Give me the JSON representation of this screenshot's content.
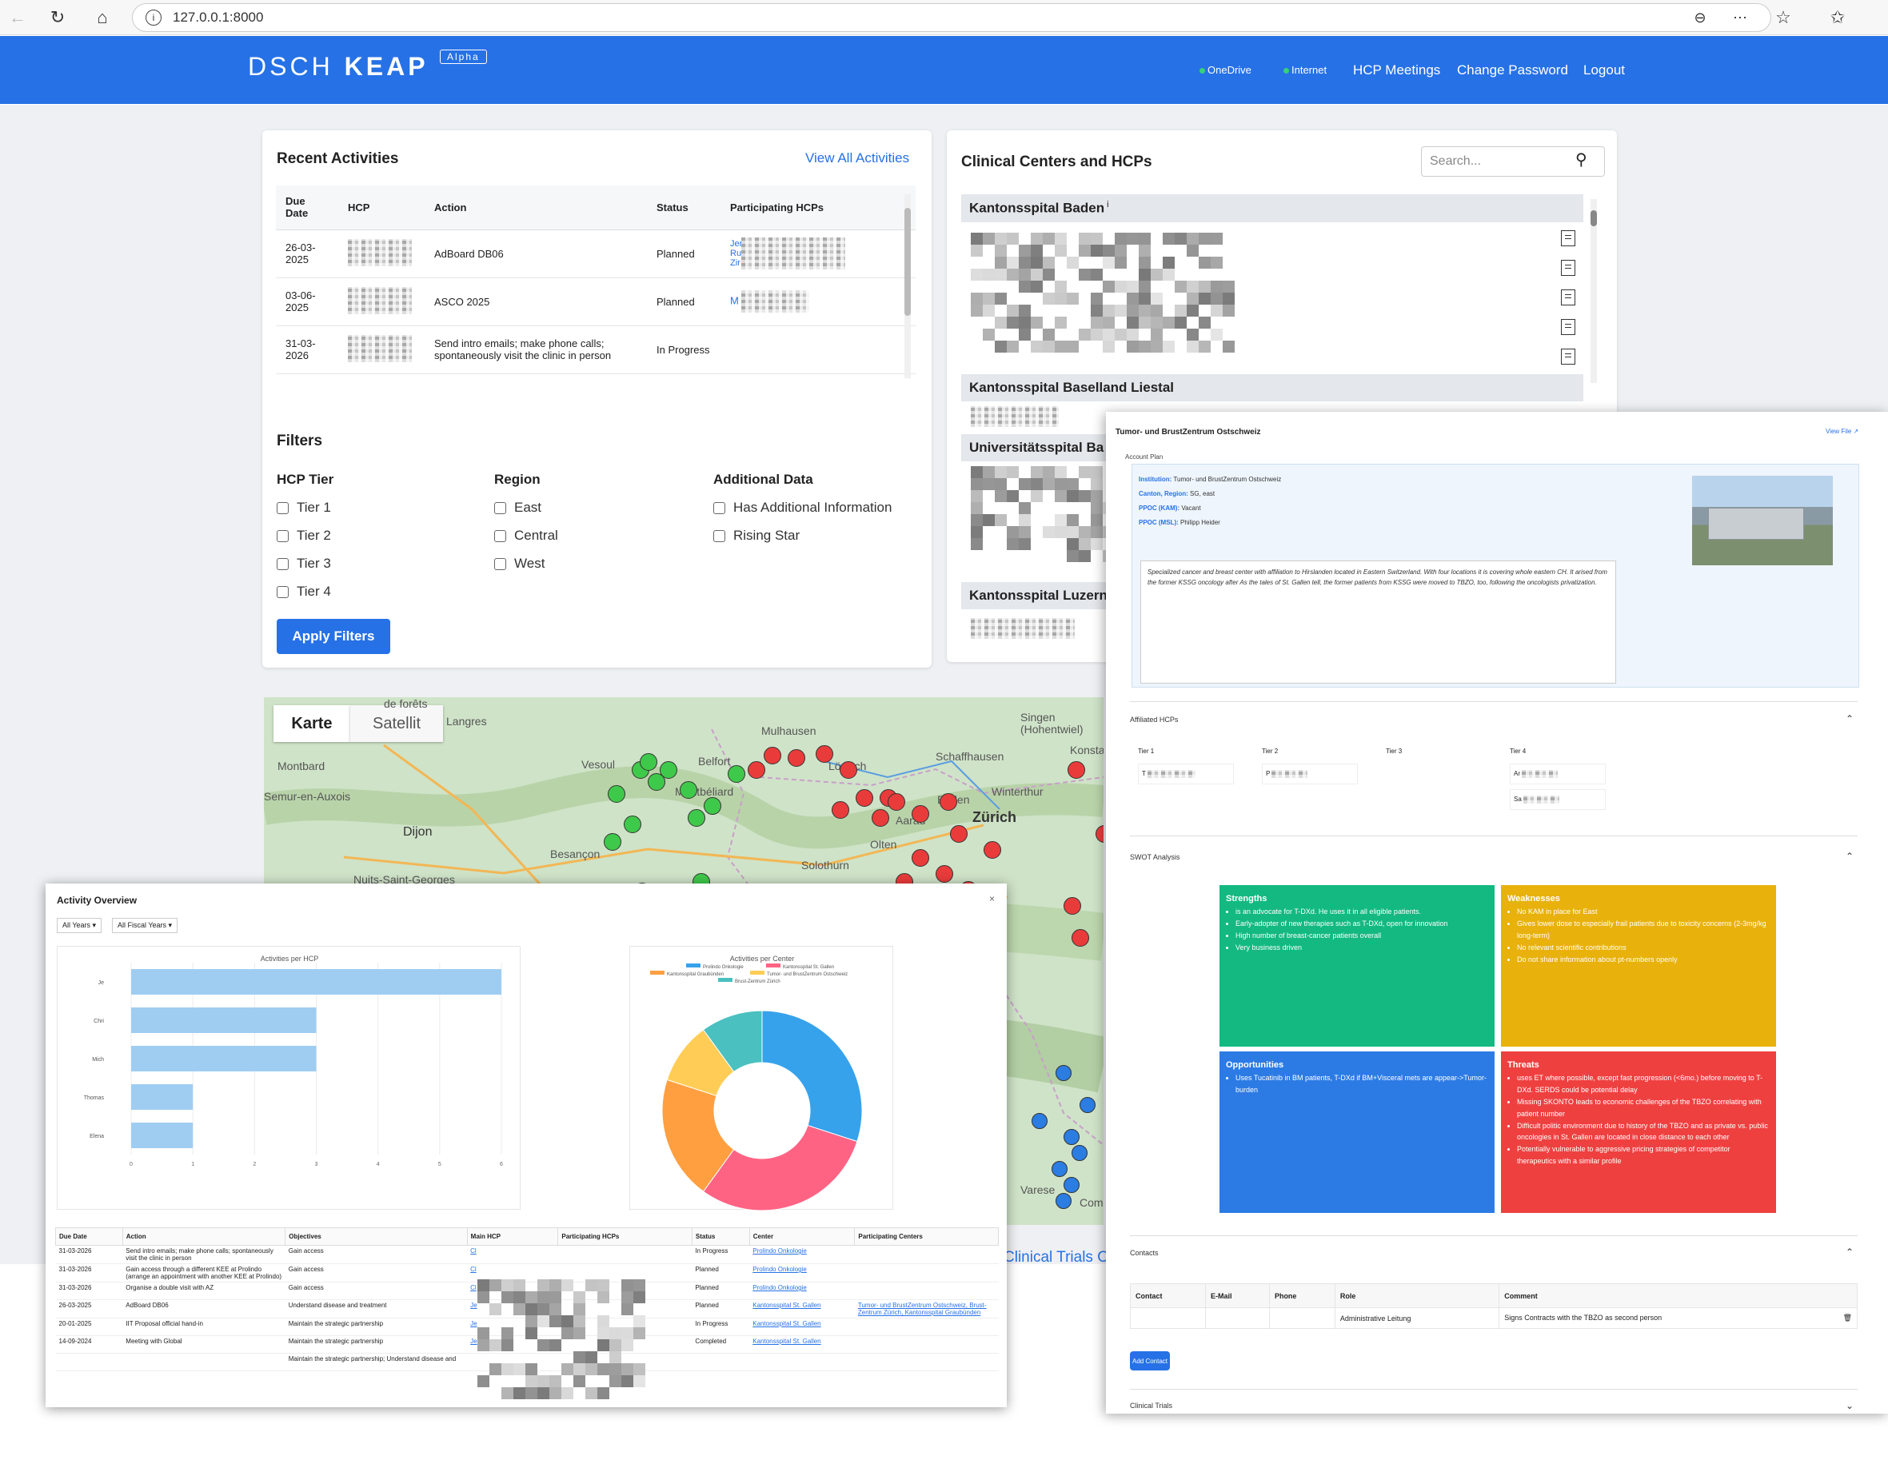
{
  "browser": {
    "url": "127.0.0.1:8000"
  },
  "app": {
    "brand_light": "DSCH",
    "brand_bold": "KEAP",
    "badge": "Alpha",
    "nav": {
      "onedrive": "OneDrive",
      "internet": "Internet",
      "hcp_meetings": "HCP Meetings",
      "change_password": "Change Password",
      "logout": "Logout"
    }
  },
  "recent": {
    "title": "Recent Activities",
    "view_all": "View All Activities",
    "headers": {
      "due": "Due Date",
      "hcp": "HCP",
      "action": "Action",
      "status": "Status",
      "participants": "Participating HCPs"
    },
    "rows": [
      {
        "due": "26-03-2025",
        "action": "AdBoard DB06",
        "status": "Planned",
        "participants": "Jer Ru Zir"
      },
      {
        "due": "03-06-2025",
        "action": "ASCO 2025",
        "status": "Planned",
        "participants": "M"
      },
      {
        "due": "31-03-2026",
        "action": "Send intro emails; make phone calls; spontaneously visit the clinic in person",
        "status": "In Progress",
        "participants": ""
      }
    ]
  },
  "filters": {
    "title": "Filters",
    "groups": {
      "tier": {
        "label": "HCP Tier",
        "options": [
          "Tier 1",
          "Tier 2",
          "Tier 3",
          "Tier 4"
        ]
      },
      "region": {
        "label": "Region",
        "options": [
          "East",
          "Central",
          "West"
        ]
      },
      "additional": {
        "label": "Additional Data",
        "options": [
          "Has Additional Information",
          "Rising Star"
        ]
      }
    },
    "apply": "Apply Filters"
  },
  "centers": {
    "title": "Clinical Centers and HCPs",
    "search_placeholder": "Search...",
    "items": [
      "Kantonsspital Baden",
      "Kantonsspital Baselland Liestal",
      "Universitätsspital Ba",
      "Kantonsspital Luzern"
    ]
  },
  "map": {
    "tab_map": "Karte",
    "tab_sat": "Satellit",
    "labels": [
      "de forêts",
      "Langres",
      "Singen (Hohentwiel)",
      "Mulhausen",
      "Lörrach",
      "Schaffhausen",
      "Konsta",
      "Montbard",
      "Vesoul",
      "Belfort",
      "Montbéliard",
      "Semur-en-Auxois",
      "Baden",
      "Winterthur",
      "Zürich",
      "Dijon",
      "Besançon",
      "Aarau",
      "Olten",
      "Solothurn",
      "Nuits-Saint-Georges",
      "Varese",
      "Com"
    ],
    "footer_link": "Clinical Trials Ov"
  },
  "overview": {
    "title": "Activity Overview",
    "year_filter": "All Years",
    "fiscal_filter": "All Fiscal Years",
    "close": "×",
    "bar_title": "Activities per HCP",
    "pie_title": "Activities per Center",
    "table_headers": [
      "Due Date",
      "Action",
      "Objectives",
      "Main HCP",
      "Participating HCPs",
      "Status",
      "Center",
      "Participating Centers"
    ],
    "table_rows": [
      {
        "due": "31-03-2026",
        "action": "Send intro emails; make phone calls; spontaneously visit the clinic in person",
        "objective": "Gain access",
        "hcp": "Cl",
        "status": "In Progress",
        "center": "Prolindo Onkologie",
        "pcenters": ""
      },
      {
        "due": "31-03-2026",
        "action": "Gain access through a different KEE at Prolindo (arrange an appointment with another KEE at Prolindo)",
        "objective": "Gain access",
        "hcp": "Cl",
        "status": "Planned",
        "center": "Prolindo Onkologie",
        "pcenters": ""
      },
      {
        "due": "31-03-2026",
        "action": "Organise a double visit with AZ",
        "objective": "Gain access",
        "hcp": "Cl",
        "status": "Planned",
        "center": "Prolindo Onkologie",
        "pcenters": ""
      },
      {
        "due": "26-03-2025",
        "action": "AdBoard DB06",
        "objective": "Understand disease and treatment",
        "hcp": "Je",
        "status": "Planned",
        "center": "Kantonsspital St. Gallen",
        "pcenters": "Tumor- und BrustZentrum Ostschweiz, Brust-Zentrum Zürich, Kantonsspital Graubünden"
      },
      {
        "due": "20-01-2025",
        "action": "IIT Proposal official hand-in",
        "objective": "Maintain the strategic partnership",
        "hcp": "Je",
        "status": "In Progress",
        "center": "Kantonsspital St. Gallen",
        "pcenters": ""
      },
      {
        "due": "14-09-2024",
        "action": "Meeting with Global",
        "objective": "Maintain the strategic partnership",
        "hcp": "Je",
        "status": "Completed",
        "center": "Kantonsspital St. Gallen",
        "pcenters": ""
      },
      {
        "due": "",
        "action": "",
        "objective": "Maintain the strategic partnership; Understand disease and",
        "hcp": "",
        "status": "",
        "center": "",
        "pcenters": ""
      }
    ]
  },
  "chart_data": [
    {
      "type": "bar",
      "title": "Activities per HCP",
      "orientation": "horizontal",
      "categories": [
        "Je",
        "Chri",
        "Mich",
        "Thomas",
        "Elena"
      ],
      "values": [
        6,
        3,
        3,
        1,
        1
      ],
      "xlim": [
        0,
        6
      ],
      "xticks": [
        "0",
        "1",
        "2",
        "3",
        "4",
        "5",
        "6"
      ],
      "color": "#9fcdf2"
    },
    {
      "type": "pie",
      "title": "Activities per Center",
      "donut": true,
      "legend_placement": "top",
      "labels": [
        "Prolindo Onkologie",
        "Kantonsspital St. Gallen",
        "Kantonsspital Graubünden",
        "Tumor- und BrustZentrum Ostschweiz",
        "Brust-Zentrum Zürich"
      ],
      "values": [
        3,
        3,
        2,
        1,
        1
      ],
      "colors": [
        "#36a2eb",
        "#ff6384",
        "#ff9f40",
        "#ffcd56",
        "#4bc0c0"
      ]
    }
  ],
  "detail": {
    "title": "Tumor- und BrustZentrum Ostschweiz",
    "view_file": "View File",
    "account_plan": "Account Plan",
    "institution_label": "Institution:",
    "institution": "Tumor- und BrustZentrum Ostschweiz",
    "canton_label": "Canton, Region:",
    "canton": "SG, east",
    "kam_label": "PPOC (KAM):",
    "kam": "Vacant",
    "msl_label": "PPOC (MSL):",
    "msl": "Philipp Heider",
    "description": "Specialized cancer and breast center with affiliation to Hirslanden located in Eastern Switzerland. With four locations it is covering whole eastern CH. It arised from the former KSSG oncology after  As the tales of St. Gallen tell, the former patients from KSSG were moved to TBZO, too, following the oncologists privatization.",
    "affiliated": "Affiliated HCPs",
    "tiers": [
      "Tier 1",
      "Tier 2",
      "Tier 3",
      "Tier 4"
    ],
    "hcp_initials": {
      "t1": "T",
      "t2": "P",
      "t4a": "Ar",
      "t4b": "Sa"
    },
    "swot_title": "SWOT Analysis",
    "swot": {
      "s_title": "Strengths",
      "s": [
        "is an advocate for T-DXd. He uses it in all eligible patients.",
        "Early-adopter of new therapies such as T-DXd, open for innovation",
        "High number of breast-cancer patients overall",
        "Very business driven"
      ],
      "w_title": "Weaknesses",
      "w": [
        "No KAM in place for East",
        "Gives lower dose to especially frail patients due to toxicity concerns (2-3mg/kg long-term)",
        "No relevant scientific contributions",
        "Do not share information about pt-numbers openly"
      ],
      "o_title": "Opportunities",
      "o": [
        "Uses Tucatinib in BM patients, T-DXd if BM+Visceral mets are appear->Tumor-burden"
      ],
      "t_title": "Threats",
      "t": [
        "uses ET where possible, except fast progression (<6mo.) before moving to T-DXd. SERDS could be potential delay",
        "Missing SKONTO leads to economic challenges of the TBZO correlating with patient number",
        "Difficult politic environment due to history of the TBZO and as private vs. public oncologies in St. Gallen are located in close distance to each other",
        "Potentially vulnerable to aggressive pricing strategies of competitor therapeutics with a similar profile"
      ]
    },
    "contacts_title": "Contacts",
    "contact_headers": [
      "Contact",
      "E-Mail",
      "Phone",
      "Role",
      "Comment"
    ],
    "contact_row": {
      "role": "Administrative Leitung",
      "comment": "Signs Contracts with the TBZO as second person"
    },
    "add_contact": "Add Contact",
    "trials": "Clinical Trials"
  }
}
